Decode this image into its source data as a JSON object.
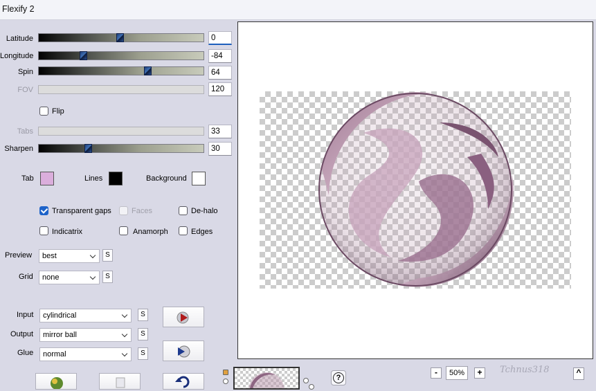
{
  "window": {
    "title": "Flexify 2"
  },
  "sliders": [
    {
      "label": "Latitude",
      "value": "0",
      "fraction": 0.49,
      "enabled": true
    },
    {
      "label": "Longitude",
      "value": "-84",
      "fraction": 0.27,
      "enabled": true
    },
    {
      "label": "Spin",
      "value": "64",
      "fraction": 0.66,
      "enabled": true
    },
    {
      "label": "FOV",
      "value": "120",
      "fraction": null,
      "enabled": false
    },
    {
      "label": "Tabs",
      "value": "33",
      "fraction": null,
      "enabled": false
    },
    {
      "label": "Sharpen",
      "value": "30",
      "fraction": 0.3,
      "enabled": true
    }
  ],
  "flip": {
    "label": "Flip",
    "checked": false
  },
  "colors": {
    "tab_label": "Tab",
    "tab_color": "#dbaedc",
    "lines_label": "Lines",
    "lines_color": "#000000",
    "background_label": "Background",
    "background_color": "#ffffff"
  },
  "options": {
    "transparent_gaps": {
      "label": "Transparent gaps",
      "checked": true
    },
    "faces": {
      "label": "Faces",
      "checked": false,
      "enabled": false
    },
    "dehalo": {
      "label": "De-halo",
      "checked": false
    },
    "indicatrix": {
      "label": "Indicatrix",
      "checked": false
    },
    "anamorph": {
      "label": "Anamorph",
      "checked": false
    },
    "edges": {
      "label": "Edges",
      "checked": false
    }
  },
  "preview": {
    "label": "Preview",
    "value": "best",
    "s": "S"
  },
  "grid": {
    "label": "Grid",
    "value": "none",
    "s": "S"
  },
  "input": {
    "label": "Input",
    "value": "cylindrical",
    "s": "S"
  },
  "output": {
    "label": "Output",
    "value": "mirror ball",
    "s": "S"
  },
  "glue": {
    "label": "Glue",
    "value": "normal",
    "s": "S"
  },
  "zoom": {
    "minus": "-",
    "value": "50%",
    "plus": "+"
  },
  "help": {
    "label": "?"
  },
  "scroll_top": {
    "label": "^"
  },
  "watermark": "Tchnus318"
}
